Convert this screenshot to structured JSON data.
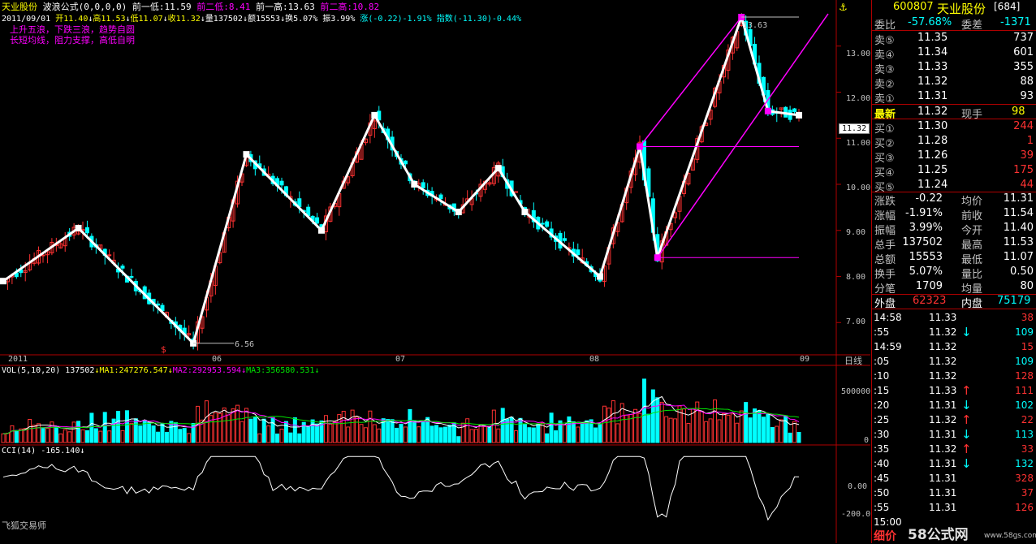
{
  "header": {
    "stock_name": "天业股份",
    "formula": "波浪公式(0,0,0,0)",
    "prev_low_label": "前一低:",
    "prev_low": "11.59",
    "prev2_low_label": "前二低:",
    "prev2_low": "8.41",
    "prev_high_label": "前一高:",
    "prev_high": "13.63",
    "prev2_high_label": "前二高:",
    "prev2_high": "10.82"
  },
  "bar_info": {
    "date": "2011/09/01",
    "open": "开11.40",
    "high": "高11.53",
    "low": "低11.07",
    "close": "收11.32",
    "vol": "量137502",
    "amount": "额15553",
    "turnover": "换5.07%",
    "amplitude": "振3.99%",
    "change": "涨(-0.22)-1.91%",
    "index": "指数(-11.30)-0.44%"
  },
  "notes": [
    "上升五浪，下跌三浪，趋势自圆",
    "长短均线，阻力支撑，高低自明"
  ],
  "price_axis": [
    "13.00",
    "12.00",
    "11.00",
    "10.00",
    "9.00",
    "8.00",
    "7.00"
  ],
  "price_current": "11.32",
  "label_high": "13.63",
  "label_low": "6.56",
  "date_axis": [
    "2011",
    "06",
    "07",
    "08",
    "09"
  ],
  "period": "日线",
  "vol_header": {
    "name": "VOL(5,10,20)",
    "val": "137502",
    "ma1": "MA1:247276.547",
    "ma2": "MA2:292953.594",
    "ma3": "MA3:356580.531"
  },
  "vol_axis": [
    "500000",
    "0"
  ],
  "cci_header": {
    "name": "CCI(14)",
    "val": "-165.140"
  },
  "cci_axis": [
    "0.00",
    "-200.0"
  ],
  "watermark": "飞狐交易师",
  "colors": {
    "up": "#ff3232",
    "down": "#00ffff",
    "wave": "#ffffff",
    "channel": "#ff00ff",
    "ma1": "#ffffff",
    "ma2": "#ff00ff",
    "ma3": "#00e600",
    "cci": "#ffffff"
  },
  "quote": {
    "code": "600807",
    "name": "天业股份",
    "count": "[684]",
    "ratio_label": "委比",
    "ratio": "-57.68%",
    "diff_label": "委差",
    "diff": "-1371",
    "sell": [
      {
        "label": "卖⑤",
        "price": "11.35",
        "vol": "737"
      },
      {
        "label": "卖④",
        "price": "11.34",
        "vol": "601"
      },
      {
        "label": "卖③",
        "price": "11.33",
        "vol": "355"
      },
      {
        "label": "卖②",
        "price": "11.32",
        "vol": "88"
      },
      {
        "label": "卖①",
        "price": "11.31",
        "vol": "93"
      }
    ],
    "last_label": "最新",
    "last": "11.32",
    "now_hand_label": "现手",
    "now_hand": "98",
    "buy": [
      {
        "label": "买①",
        "price": "11.30",
        "vol": "244"
      },
      {
        "label": "买②",
        "price": "11.28",
        "vol": "1"
      },
      {
        "label": "买③",
        "price": "11.26",
        "vol": "39"
      },
      {
        "label": "买④",
        "price": "11.25",
        "vol": "175"
      },
      {
        "label": "买⑤",
        "price": "11.24",
        "vol": "44"
      }
    ],
    "stats": [
      {
        "l1": "涨跌",
        "v1": "-0.22",
        "l2": "均价",
        "v2": "11.31"
      },
      {
        "l1": "涨幅",
        "v1": "-1.91%",
        "l2": "前收",
        "v2": "11.54"
      },
      {
        "l1": "振幅",
        "v1": "3.99%",
        "l2": "今开",
        "v2": "11.40"
      },
      {
        "l1": "总手",
        "v1": "137502",
        "l2": "最高",
        "v2": "11.53"
      },
      {
        "l1": "总额",
        "v1": "15553",
        "l2": "最低",
        "v2": "11.07"
      },
      {
        "l1": "换手",
        "v1": "5.07%",
        "l2": "量比",
        "v2": "0.50"
      },
      {
        "l1": "分笔",
        "v1": "1709",
        "l2": "均量",
        "v2": "80"
      }
    ],
    "outer_label": "外盘",
    "outer": "62323",
    "inner_label": "内盘",
    "inner": "75179"
  },
  "ticks": [
    {
      "time": "14:58",
      "price": "11.33",
      "arrow": "",
      "vol": "38"
    },
    {
      "time": ":55",
      "price": "11.32",
      "arrow": "↓",
      "vol": "109"
    },
    {
      "time": "14:59",
      "price": "11.32",
      "arrow": "",
      "vol": "15"
    },
    {
      "time": ":05",
      "price": "11.32",
      "arrow": "",
      "vol": "109"
    },
    {
      "time": ":10",
      "price": "11.32",
      "arrow": "",
      "vol": "128"
    },
    {
      "time": ":15",
      "price": "11.33",
      "arrow": "↑",
      "vol": "111"
    },
    {
      "time": ":20",
      "price": "11.31",
      "arrow": "↓",
      "vol": "102"
    },
    {
      "time": ":25",
      "price": "11.32",
      "arrow": "↑",
      "vol": "22"
    },
    {
      "time": ":30",
      "price": "11.31",
      "arrow": "↓",
      "vol": "113"
    },
    {
      "time": ":35",
      "price": "11.32",
      "arrow": "↑",
      "vol": "33"
    },
    {
      "time": ":40",
      "price": "11.31",
      "arrow": "↓",
      "vol": "132"
    },
    {
      "time": ":45",
      "price": "11.31",
      "arrow": "",
      "vol": "328"
    },
    {
      "time": ":50",
      "price": "11.31",
      "arrow": "",
      "vol": "37"
    },
    {
      "time": ":55",
      "price": "11.31",
      "arrow": "",
      "vol": "126"
    },
    {
      "time": "15:00",
      "price": "",
      "arrow": "",
      "vol": ""
    }
  ],
  "footer": {
    "detail": "细价",
    "site": "58公式网",
    "url": "www.58gs.com"
  },
  "chart_data": {
    "type": "candlestick",
    "price_ylim": [
      6.3,
      14.0
    ],
    "wave_points": [
      [
        0,
        7.9
      ],
      [
        17,
        9.05
      ],
      [
        43,
        6.55
      ],
      [
        55,
        10.65
      ],
      [
        72,
        9.0
      ],
      [
        84,
        11.5
      ],
      [
        93,
        10.0
      ],
      [
        103,
        9.4
      ],
      [
        112,
        10.35
      ],
      [
        118,
        9.4
      ],
      [
        135,
        8.0
      ],
      [
        144,
        10.82
      ],
      [
        148,
        8.41
      ],
      [
        167,
        13.63
      ],
      [
        173,
        11.59
      ],
      [
        180,
        11.5
      ]
    ],
    "vol_ylim": [
      0,
      700000
    ],
    "cci_ylim": [
      -250,
      120
    ]
  }
}
